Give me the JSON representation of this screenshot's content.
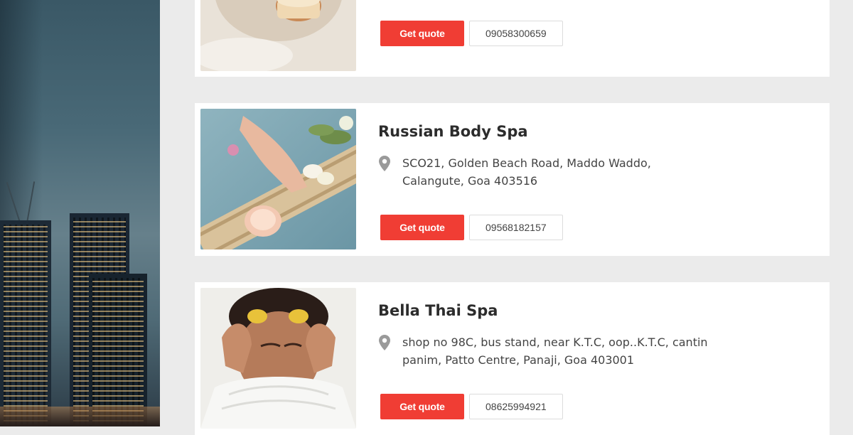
{
  "listings": [
    {
      "name": "",
      "address_line1": "",
      "address_line2": "",
      "quote_label": "Get quote",
      "phone": "09058300659"
    },
    {
      "name": "Russian Body Spa",
      "address_line1": "SCO21, Golden Beach Road, Maddo Waddo,",
      "address_line2": "Calangute, Goa 403516",
      "quote_label": "Get quote",
      "phone": "09568182157"
    },
    {
      "name": "Bella Thai Spa",
      "address_line1": "shop no 98C, bus stand, near K.T.C, oop..K.T.C, cantin",
      "address_line2": "panim, Patto Centre, Panaji, Goa 403001",
      "quote_label": "Get quote",
      "phone": "08625994921"
    }
  ],
  "colors": {
    "accent": "#f03d34",
    "page_bg": "#ebebeb",
    "card_bg": "#ffffff"
  },
  "icons": {
    "address": "location-pin-icon"
  }
}
